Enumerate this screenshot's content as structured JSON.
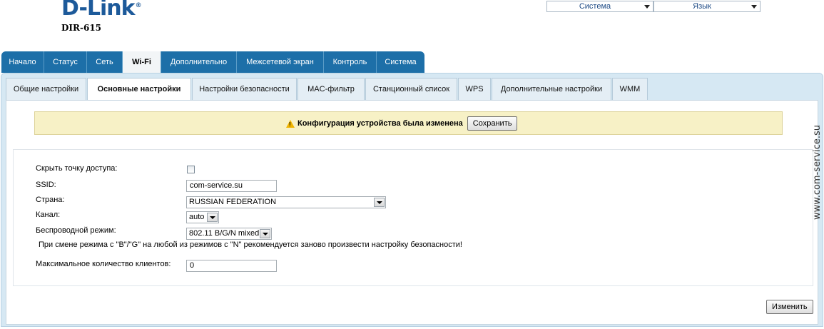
{
  "brand": {
    "logo": "D-Link",
    "model": "DIR-615"
  },
  "top": {
    "system_select": "Система",
    "language_select": "Язык"
  },
  "main_tabs": [
    "Начало",
    "Статус",
    "Сеть",
    "Wi-Fi",
    "Дополнительно",
    "Межсетевой экран",
    "Контроль",
    "Система"
  ],
  "sub_tabs": [
    "Общие настройки",
    "Основные настройки",
    "Настройки безопасности",
    "MAC-фильтр",
    "Станционный список",
    "WPS",
    "Дополнительные настройки",
    "WMM"
  ],
  "notice": {
    "text": "Конфигурация устройства была изменена",
    "save_label": "Сохранить"
  },
  "form": {
    "hide_ap_label": "Скрыть точку доступа:",
    "ssid_label": "SSID:",
    "ssid_value": "com-service.su",
    "country_label": "Страна:",
    "country_value": "RUSSIAN FEDERATION",
    "channel_label": "Канал:",
    "channel_value": "auto",
    "mode_label": "Беспроводной режим:",
    "mode_value": "802.11 B/G/N mixed",
    "mode_hint": "При смене режима с \"B\"/\"G\" на любой из режимов с \"N\" рекомендуется заново произвести настройку безопасности!",
    "max_clients_label": "Максимальное количество клиентов:",
    "max_clients_value": "0",
    "apply_label": "Изменить"
  },
  "watermark": "www.com-service.su"
}
